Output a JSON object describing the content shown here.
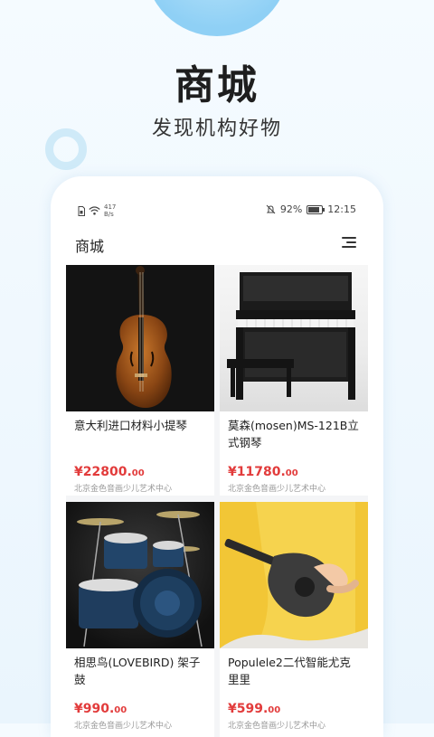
{
  "hero": {
    "title": "商城",
    "subtitle": "发现机构好物"
  },
  "status_bar": {
    "net_speed_value": "417",
    "net_speed_unit": "B/s",
    "battery": "92%",
    "time": "12:15"
  },
  "app_bar": {
    "title": "商城",
    "menu_icon": "menu-icon"
  },
  "products": [
    {
      "name": "意大利进口材料小提琴",
      "price_main": "¥22800.",
      "price_cents": "00",
      "shop": "北京金色音画少儿艺术中心",
      "image": "violin"
    },
    {
      "name": "莫森(mosen)MS-121B立式钢琴",
      "price_main": "¥11780.",
      "price_cents": "00",
      "shop": "北京金色音画少儿艺术中心",
      "image": "piano"
    },
    {
      "name": "相思鸟(LOVEBIRD) 架子鼓",
      "price_main": "¥990.",
      "price_cents": "00",
      "shop": "北京金色音画少儿艺术中心",
      "image": "drum-kit"
    },
    {
      "name": "Populele2二代智能尤克里里",
      "price_main": "¥599.",
      "price_cents": "00",
      "shop": "北京金色音画少儿艺术中心",
      "image": "ukulele"
    }
  ],
  "colors": {
    "price": "#e23b3b",
    "accent_blue": "#8fd0f5"
  }
}
